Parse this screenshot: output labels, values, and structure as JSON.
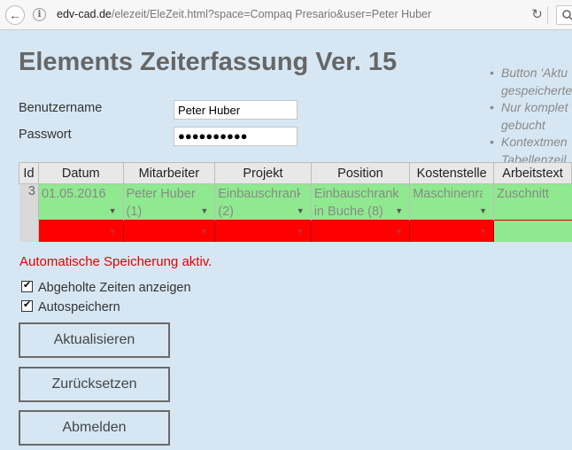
{
  "browser": {
    "url_host": "edv-cad.de",
    "url_path": "/elezeit/EleZeit.html?space=Compaq Presario&user=Peter Huber"
  },
  "page": {
    "title": "Elements Zeiterfassung Ver. 15",
    "notes": [
      "Button 'Aktu",
      "gespeicherte",
      "Nur komplet",
      "gebucht",
      "Kontextmen",
      "Tabellenzeil"
    ]
  },
  "login": {
    "username_label": "Benutzername",
    "username_value": "Peter Huber",
    "password_label": "Passwort",
    "password_dots": "●●●●●●●●●●"
  },
  "table": {
    "headers": [
      "Id",
      "Datum",
      "Mitarbeiter",
      "Projekt",
      "Position",
      "Kostenstelle",
      "Arbeitstext"
    ],
    "row": {
      "id": "3",
      "datum": "01.05.2016",
      "mitarbeiter_1": "Peter Huber",
      "mitarbeiter_2": "(1)",
      "projekt_1": "Einbauschrank",
      "projekt_2": "(2)",
      "position_1": "Einbauschrank",
      "position_2": "in Buche (8)",
      "kostenstelle": "Maschinenrau",
      "arbeitstext": "Zuschnitt"
    },
    "dropdown_arrow": "▼"
  },
  "status": {
    "autosave_message": "Automatische Speicherung aktiv."
  },
  "options": {
    "show_fetched_label": "Abgeholte Zeiten anzeigen",
    "autosave_label": "Autospeichern"
  },
  "buttons": {
    "refresh": "Aktualisieren",
    "reset": "Zurücksetzen",
    "logout": "Abmelden"
  },
  "icons": {
    "back": "back-arrow-icon",
    "info": "info-icon",
    "reload": "reload-icon",
    "search": "search-icon"
  },
  "colors": {
    "background": "#d6e7f3",
    "row_green": "#8fe98f",
    "row_red": "#ff0000",
    "autosave_text": "#e30000"
  }
}
